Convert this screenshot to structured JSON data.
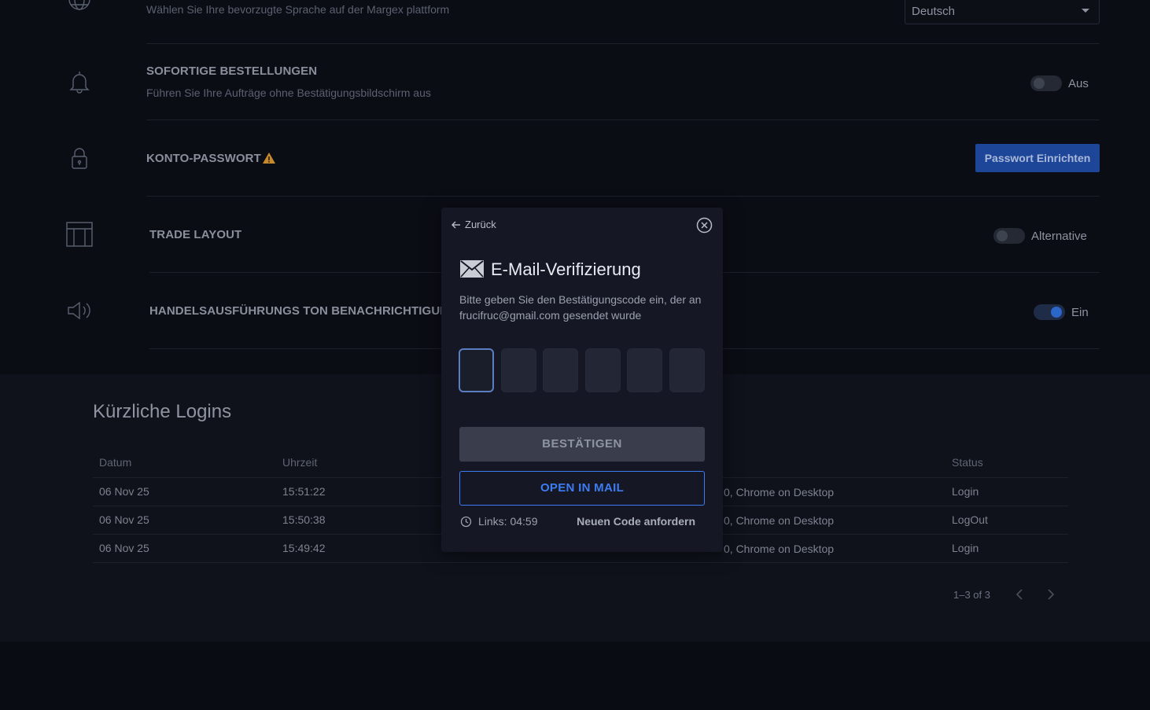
{
  "settings": {
    "language": {
      "desc": "Wählen Sie Ihre bevorzugte Sprache auf der Margex plattform",
      "selected": "Deutsch"
    },
    "instant_orders": {
      "title": "SOFORTIGE BESTELLUNGEN",
      "desc": "Führen Sie Ihre Aufträge ohne Bestätigungsbildschirm aus",
      "toggle_label": "Aus",
      "enabled": false
    },
    "account_password": {
      "title": "KONTO-PASSWORT",
      "button_label": "Passwort Einrichten"
    },
    "trade_layout": {
      "title": "TRADE LAYOUT",
      "toggle_label": "Alternative",
      "enabled": false
    },
    "trade_sound": {
      "title": "HANDELSAUSFÜHRUNGS TON BENACHRICHTIGUNG",
      "toggle_label": "Ein",
      "enabled": true
    }
  },
  "logins": {
    "heading": "Kürzliche Logins",
    "columns": [
      "Datum",
      "Uhrzeit",
      "Status"
    ],
    "rows": [
      {
        "date": "06 Nov 25",
        "time": "15:51:22",
        "device": "0, Chrome on Desktop",
        "status": "Login"
      },
      {
        "date": "06 Nov 25",
        "time": "15:50:38",
        "device": "0, Chrome on Desktop",
        "status": "LogOut"
      },
      {
        "date": "06 Nov 25",
        "time": "15:49:42",
        "device": "0, Chrome on Desktop",
        "status": "Login"
      }
    ],
    "pagination": "1–3 of 3"
  },
  "modal": {
    "back_label": "Zurück",
    "title": "E-Mail-Verifizierung",
    "desc": "Bitte geben Sie den Bestätigungscode ein, der an frucifruc@gmail.com gesendet wurde",
    "code_length": 6,
    "confirm_label": "BESTÄTIGEN",
    "open_mail_label": "OPEN IN MAIL",
    "timer_label": "Links: 04:59",
    "resend_label": "Neuen Code anfordern"
  },
  "colors": {
    "accent": "#3d7cf0",
    "button_blue": "#1d4699",
    "warning": "#c98a2a"
  }
}
